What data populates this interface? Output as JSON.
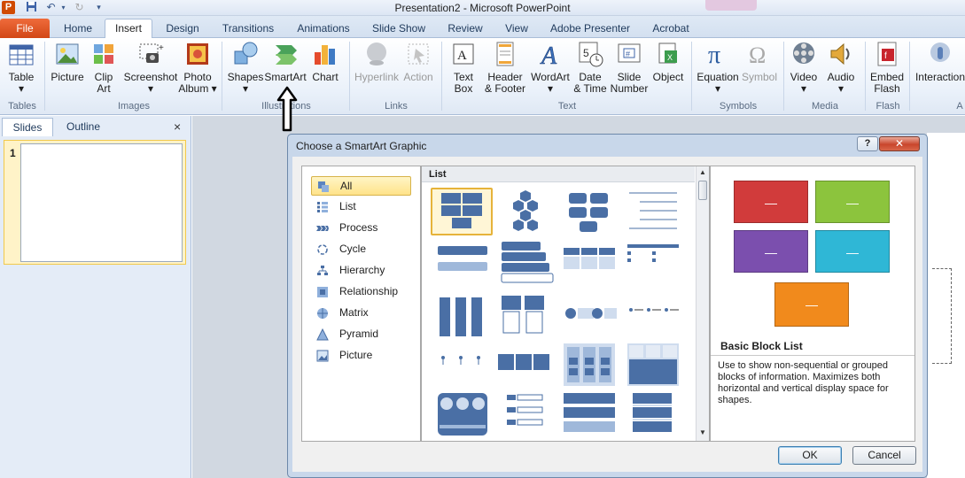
{
  "window": {
    "title": "Presentation2 - Microsoft PowerPoint",
    "app_icon": "P"
  },
  "quick_access": {
    "icons": [
      "save-icon",
      "undo-icon",
      "redo-icon",
      "customize-icon"
    ]
  },
  "tabs": [
    {
      "label": "File"
    },
    {
      "label": "Home"
    },
    {
      "label": "Insert"
    },
    {
      "label": "Design"
    },
    {
      "label": "Transitions"
    },
    {
      "label": "Animations"
    },
    {
      "label": "Slide Show"
    },
    {
      "label": "Review"
    },
    {
      "label": "View"
    },
    {
      "label": "Adobe Presenter"
    },
    {
      "label": "Acrobat"
    }
  ],
  "active_tab": "Insert",
  "ribbon": {
    "buttons": [
      {
        "line1": "Table",
        "line2": "▾",
        "icon": "table-icon"
      },
      {
        "line1": "Picture",
        "line2": "",
        "icon": "picture-icon"
      },
      {
        "line1": "Clip",
        "line2": "Art",
        "icon": "clip-art-icon"
      },
      {
        "line1": "Screenshot",
        "line2": "▾",
        "icon": "screenshot-icon"
      },
      {
        "line1": "Photo",
        "line2": "Album ▾",
        "icon": "photo-album-icon"
      },
      {
        "line1": "Shapes",
        "line2": "▾",
        "icon": "shapes-icon"
      },
      {
        "line1": "SmartArt",
        "line2": "",
        "icon": "smartart-icon"
      },
      {
        "line1": "Chart",
        "line2": "",
        "icon": "chart-icon"
      },
      {
        "line1": "Hyperlink",
        "line2": "",
        "icon": "hyperlink-icon",
        "disabled": true
      },
      {
        "line1": "Action",
        "line2": "",
        "icon": "action-icon",
        "disabled": true
      },
      {
        "line1": "Text",
        "line2": "Box",
        "icon": "text-box-icon"
      },
      {
        "line1": "Header",
        "line2": "& Footer",
        "icon": "header-footer-icon"
      },
      {
        "line1": "WordArt",
        "line2": "▾",
        "icon": "wordart-icon"
      },
      {
        "line1": "Date",
        "line2": "& Time",
        "icon": "date-time-icon"
      },
      {
        "line1": "Slide",
        "line2": "Number",
        "icon": "slide-number-icon"
      },
      {
        "line1": "Object",
        "line2": "",
        "icon": "object-icon"
      },
      {
        "line1": "Equation",
        "line2": "▾",
        "icon": "equation-icon"
      },
      {
        "line1": "Symbol",
        "line2": "",
        "icon": "symbol-icon",
        "disabled": true
      },
      {
        "line1": "Video",
        "line2": "▾",
        "icon": "video-icon"
      },
      {
        "line1": "Audio",
        "line2": "▾",
        "icon": "audio-icon"
      },
      {
        "line1": "Embed",
        "line2": "Flash",
        "icon": "embed-flash-icon"
      },
      {
        "line1": "Interaction",
        "line2": "",
        "icon": "interaction-icon"
      }
    ],
    "groups": [
      "Tables",
      "Images",
      "Illustrations",
      "Links",
      "Text",
      "Symbols",
      "Media",
      "Flash",
      "A"
    ]
  },
  "left_panel": {
    "tabs": [
      "Slides",
      "Outline"
    ],
    "close": "×",
    "slide_number": "1"
  },
  "dialog": {
    "title": "Choose a SmartArt Graphic",
    "help": "?",
    "close": "✕",
    "categories": [
      {
        "label": "All",
        "icon": "all-icon",
        "selected": true
      },
      {
        "label": "List",
        "icon": "list-icon"
      },
      {
        "label": "Process",
        "icon": "process-icon"
      },
      {
        "label": "Cycle",
        "icon": "cycle-icon"
      },
      {
        "label": "Hierarchy",
        "icon": "hierarchy-icon"
      },
      {
        "label": "Relationship",
        "icon": "relationship-icon"
      },
      {
        "label": "Matrix",
        "icon": "matrix-icon"
      },
      {
        "label": "Pyramid",
        "icon": "pyramid-icon"
      },
      {
        "label": "Picture",
        "icon": "picture-category-icon"
      }
    ],
    "gallery_heading": "List",
    "selected_layout": "Basic Block List",
    "preview": {
      "title": "Basic Block List",
      "description": "Use to show non-sequential or grouped blocks of information. Maximizes both horizontal and vertical display space for shapes.",
      "block_colors": [
        "#d13b3b",
        "#8cc43d",
        "#7b4fae",
        "#2fb7d6",
        "#f18a1c"
      ],
      "block_label": "—"
    },
    "ok_label": "OK",
    "cancel_label": "Cancel"
  },
  "colors": {
    "accent_blue": "#4a6fa5",
    "selection_gold": "#e6b33a",
    "file_tab": "#d24716"
  }
}
